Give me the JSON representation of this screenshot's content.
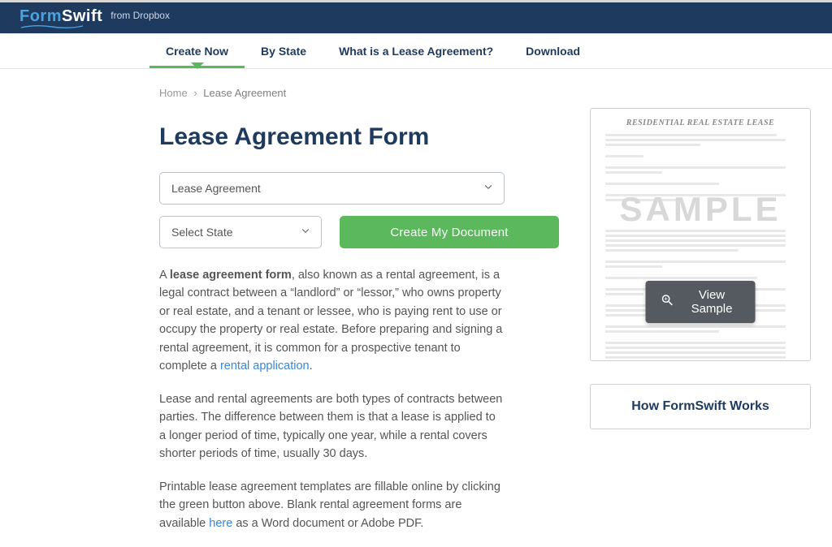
{
  "brand": {
    "part1": "Form",
    "part2": "Swift",
    "suffix": "from Dropbox"
  },
  "nav": {
    "items": [
      {
        "label": "Create Now",
        "active": true
      },
      {
        "label": "By State",
        "active": false
      },
      {
        "label": "What is a Lease Agreement?",
        "active": false
      },
      {
        "label": "Download",
        "active": false
      }
    ]
  },
  "breadcrumb": {
    "home": "Home",
    "sep": "›",
    "current": "Lease Agreement"
  },
  "title": "Lease Agreement Form",
  "form": {
    "doc_type_label": "Lease Agreement",
    "state_label": "Select State",
    "create_button": "Create My Document"
  },
  "paragraphs": {
    "p1_a": "A ",
    "p1_strong": "lease agreement form",
    "p1_b": ", also known as a rental agreement, is a legal contract between a “landlord” or “lessor,” who owns property or real estate, and a tenant or lessee, who is paying rent to use or occupy the property or real estate. Before preparing and signing a rental agreement, it is common for a prospective tenant to complete a ",
    "p1_link": "rental application",
    "p1_c": ".",
    "p2": "Lease and rental agreements are both types of contracts between parties. The difference between them is that a lease is applied to a longer period of time, typically one year, while a rental covers shorter periods of time, usually 30 days.",
    "p3_a": "Printable lease agreement templates are fillable online by clicking the green button above. Blank rental agreement forms are available ",
    "p3_link": "here",
    "p3_b": " as a Word document or Adobe PDF."
  },
  "sample": {
    "doc_title": "RESIDENTIAL REAL ESTATE LEASE",
    "watermark": "SAMPLE",
    "view_button": "View Sample"
  },
  "how": {
    "title": "How FormSwift Works"
  }
}
